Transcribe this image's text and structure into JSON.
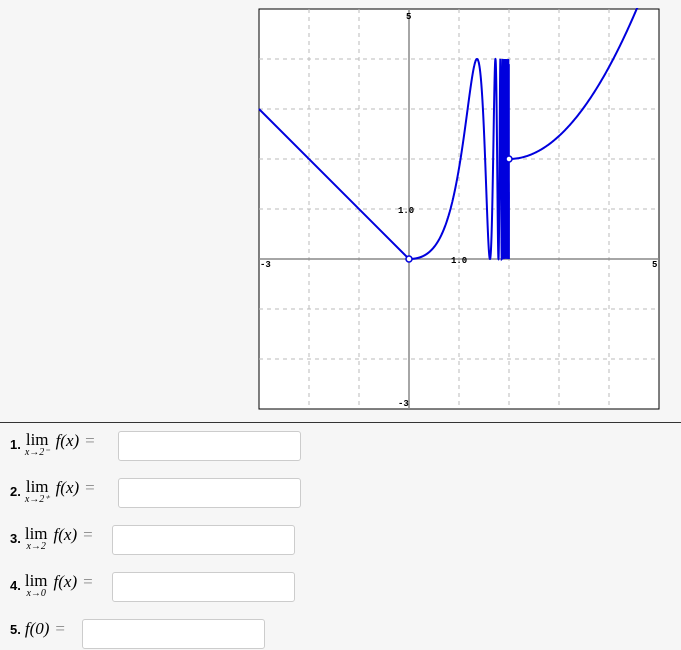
{
  "graph": {
    "xmin": -3,
    "xmax": 5,
    "ymin": -3,
    "ymax": 5,
    "labels": {
      "xmin": "-3",
      "xmax": "5",
      "ymin": "-3",
      "ymax": "5",
      "xtick": "1.0",
      "ytick": "1.0"
    },
    "curve_color": "#0000dd"
  },
  "questions": [
    {
      "num": "1.",
      "lim": "lim",
      "sub": "x→2⁻",
      "expr": "f(x)",
      "eq": "=",
      "value": ""
    },
    {
      "num": "2.",
      "lim": "lim",
      "sub": "x→2⁺",
      "expr": "f(x)",
      "eq": "=",
      "value": ""
    },
    {
      "num": "3.",
      "lim": "lim",
      "sub": "x→2",
      "expr": "f(x)",
      "eq": "=",
      "value": ""
    },
    {
      "num": "4.",
      "lim": "lim",
      "sub": "x→0",
      "expr": "f(x)",
      "eq": "=",
      "value": ""
    },
    {
      "num": "5.",
      "expr": "f(0)",
      "eq": "=",
      "value": ""
    }
  ]
}
